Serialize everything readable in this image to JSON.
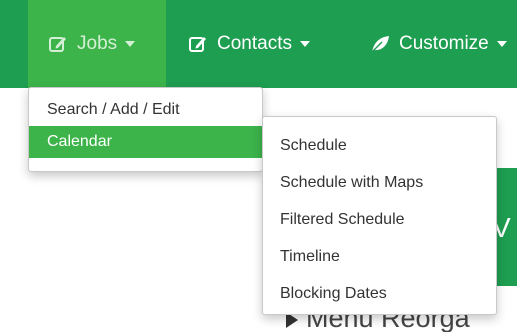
{
  "navbar": {
    "items": [
      {
        "label": "Jobs",
        "icon": "edit-icon",
        "active": true
      },
      {
        "label": "Contacts",
        "icon": "edit-icon",
        "active": false
      },
      {
        "label": "Customize",
        "icon": "leaf-icon",
        "active": false
      }
    ],
    "colors": {
      "bar": "#1e9e50",
      "active": "#3cb44a"
    }
  },
  "jobs_menu": {
    "items": [
      {
        "label": "Search / Add / Edit",
        "active": false
      },
      {
        "label": "Calendar",
        "active": true
      }
    ]
  },
  "calendar_submenu": {
    "items": [
      {
        "label": "Schedule"
      },
      {
        "label": "Schedule with Maps"
      },
      {
        "label": "Filtered Schedule"
      },
      {
        "label": "Timeline"
      },
      {
        "label": "Blocking Dates"
      }
    ]
  },
  "background": {
    "panel_letter": "V",
    "menu_reorg_text": "Menu Reorga"
  }
}
